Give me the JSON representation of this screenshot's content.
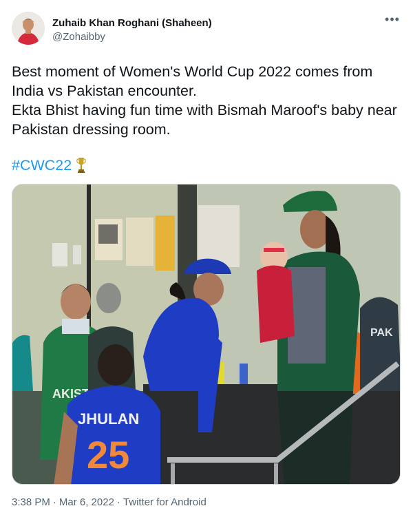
{
  "author": {
    "display_name": "Zuhaib Khan Roghani (Shaheen)",
    "handle": "@Zohaibby"
  },
  "more_icon": "more-horizontal-icon",
  "tweet": {
    "lines": [
      "Best moment of Women's World Cup 2022 comes from India vs Pakistan encounter.",
      "Ekta Bhist having fun time with Bismah Maroof's baby near Pakistan dressing room."
    ],
    "hashtag": "#CWC22",
    "hashtag_emoji": "trophy-icon"
  },
  "media": {
    "jersey_text_left": "AKISTAN",
    "jersey_name": "JHULAN",
    "jersey_number": "25",
    "jersey_text_right": "PAK"
  },
  "footer": {
    "time": "3:38 PM",
    "date": "Mar 6, 2022",
    "source": "Twitter for Android"
  },
  "colors": {
    "link": "#1d9bf0",
    "secondary": "#536471",
    "primary": "#0f1419",
    "india_blue": "#1f3cc4",
    "pakistan_green": "#1a6b3a"
  }
}
